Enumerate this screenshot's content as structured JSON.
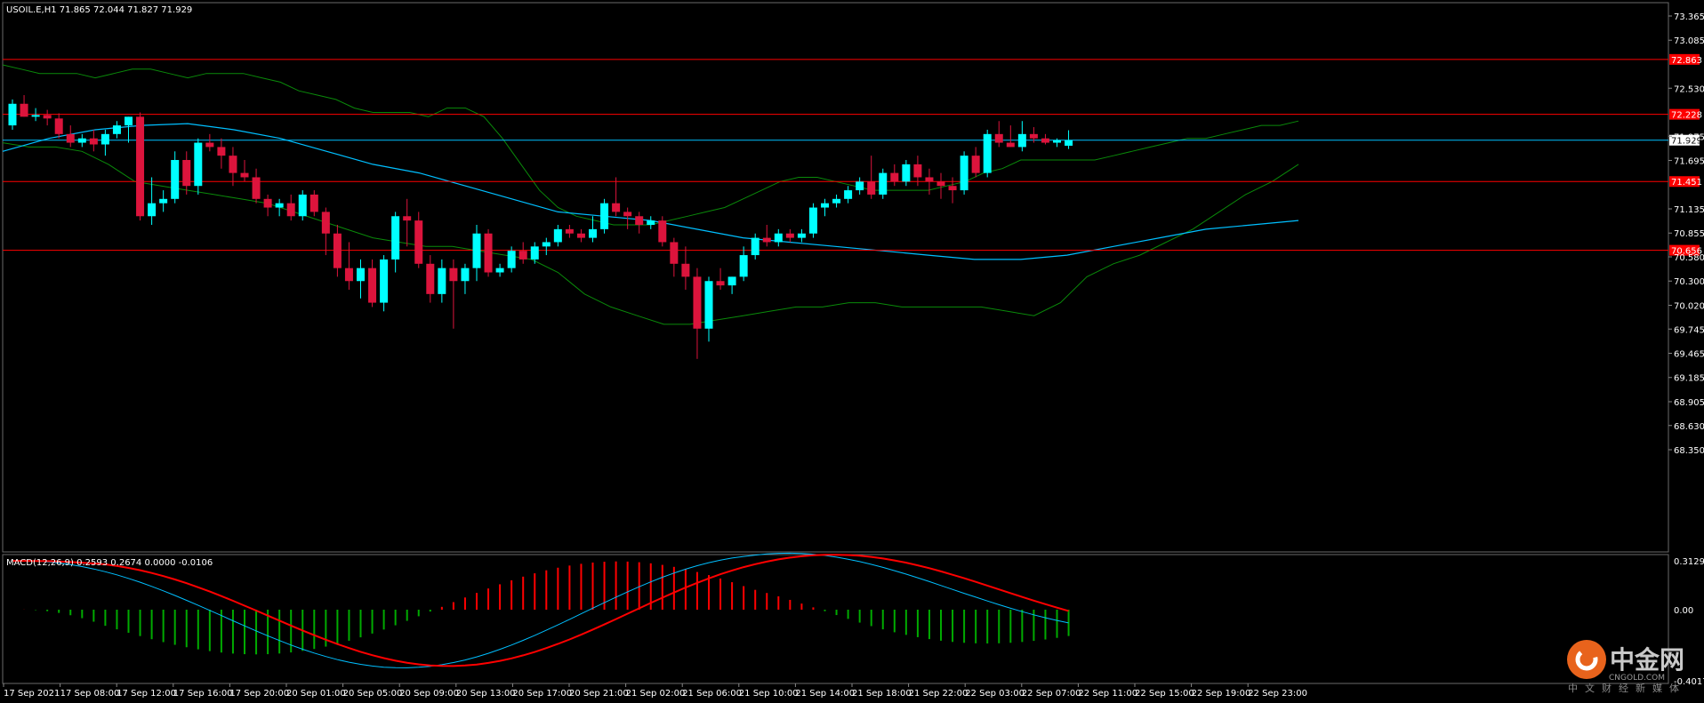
{
  "header": {
    "symbol_line": "USOIL.E,H1  71.865 72.044 71.827 71.929",
    "macd_line": "MACD(12,26,9) 0.2593 0.2674 0.0000 -0.0106"
  },
  "colors": {
    "background": "#000000",
    "bull": "#00ffff",
    "bear": "#dc143c",
    "resistance": "#ff0000",
    "bollinger": "#0a8a0a",
    "ma": "#00bfff",
    "current_price": "#00bfff",
    "macd_line": "#00bfff",
    "signal_line": "#ff0000",
    "hist_pos": "#ff0000",
    "hist_neg": "#00aa00"
  },
  "price_axis": {
    "ticks": [
      "73.365",
      "73.085",
      "72.530",
      "71.975",
      "71.695",
      "71.135",
      "70.855",
      "70.580",
      "70.300",
      "70.020",
      "69.745",
      "69.465",
      "69.185",
      "68.905",
      "68.630",
      "68.350"
    ]
  },
  "macd_axis": {
    "ticks": [
      "0.3129",
      "0.00",
      "-0.4017"
    ]
  },
  "time_axis": {
    "labels": [
      "17 Sep 2021",
      "17 Sep 08:00",
      "17 Sep 12:00",
      "17 Sep 16:00",
      "17 Sep 20:00",
      "20 Sep 01:00",
      "20 Sep 05:00",
      "20 Sep 09:00",
      "20 Sep 13:00",
      "20 Sep 17:00",
      "20 Sep 21:00",
      "21 Sep 02:00",
      "21 Sep 06:00",
      "21 Sep 10:00",
      "21 Sep 14:00",
      "21 Sep 18:00",
      "21 Sep 22:00",
      "22 Sep 03:00",
      "22 Sep 07:00",
      "22 Sep 11:00",
      "22 Sep 15:00",
      "22 Sep 19:00",
      "22 Sep 23:00"
    ]
  },
  "level_tags": {
    "l1": "72.863",
    "l2": "72.228",
    "current": "71.929",
    "l3": "71.451",
    "l4": "70.656"
  },
  "logo": {
    "cn": "中金网",
    "en": "CNGOLD.COM",
    "sub": "中文财经新媒体"
  },
  "chart_data": {
    "type": "candlestick",
    "symbol": "USOIL.E",
    "timeframe": "H1",
    "ylim": [
      68.35,
      73.5
    ],
    "horizontal_levels": [
      72.863,
      72.228,
      71.929,
      71.451,
      70.656
    ],
    "candles": [
      [
        72.1,
        72.4,
        72.05,
        72.35
      ],
      [
        72.35,
        72.45,
        72.2,
        72.2
      ],
      [
        72.2,
        72.3,
        72.15,
        72.22
      ],
      [
        72.22,
        72.28,
        72.1,
        72.18
      ],
      [
        72.18,
        72.24,
        71.95,
        72.0
      ],
      [
        72.0,
        72.1,
        71.85,
        71.9
      ],
      [
        71.9,
        72.0,
        71.85,
        71.95
      ],
      [
        71.95,
        72.05,
        71.8,
        71.88
      ],
      [
        71.88,
        72.05,
        71.75,
        72.0
      ],
      [
        72.0,
        72.15,
        71.95,
        72.1
      ],
      [
        72.1,
        72.2,
        71.9,
        72.2
      ],
      [
        72.2,
        72.25,
        71.0,
        71.05
      ],
      [
        71.05,
        71.5,
        70.95,
        71.2
      ],
      [
        71.2,
        71.35,
        71.1,
        71.25
      ],
      [
        71.25,
        71.8,
        71.2,
        71.7
      ],
      [
        71.7,
        71.8,
        71.3,
        71.4
      ],
      [
        71.4,
        71.95,
        71.3,
        71.9
      ],
      [
        71.9,
        72.0,
        71.8,
        71.85
      ],
      [
        71.85,
        71.95,
        71.6,
        71.75
      ],
      [
        71.75,
        71.85,
        71.4,
        71.55
      ],
      [
        71.55,
        71.7,
        71.45,
        71.5
      ],
      [
        71.5,
        71.6,
        71.2,
        71.25
      ],
      [
        71.25,
        71.3,
        71.05,
        71.15
      ],
      [
        71.15,
        71.25,
        71.05,
        71.2
      ],
      [
        71.2,
        71.3,
        71.0,
        71.05
      ],
      [
        71.05,
        71.35,
        71.0,
        71.3
      ],
      [
        71.3,
        71.35,
        71.05,
        71.1
      ],
      [
        71.1,
        71.15,
        70.6,
        70.85
      ],
      [
        70.85,
        70.95,
        70.35,
        70.45
      ],
      [
        70.45,
        70.75,
        70.2,
        70.3
      ],
      [
        70.3,
        70.55,
        70.1,
        70.45
      ],
      [
        70.45,
        70.55,
        70.0,
        70.05
      ],
      [
        70.05,
        70.6,
        69.95,
        70.55
      ],
      [
        70.55,
        71.1,
        70.4,
        71.05
      ],
      [
        71.05,
        71.25,
        70.7,
        71.0
      ],
      [
        71.0,
        71.1,
        70.45,
        70.5
      ],
      [
        70.5,
        70.6,
        70.05,
        70.15
      ],
      [
        70.15,
        70.55,
        70.05,
        70.45
      ],
      [
        70.45,
        70.55,
        69.75,
        70.3
      ],
      [
        70.3,
        70.5,
        70.15,
        70.45
      ],
      [
        70.45,
        70.95,
        70.3,
        70.85
      ],
      [
        70.85,
        70.9,
        70.35,
        70.4
      ],
      [
        70.4,
        70.5,
        70.35,
        70.45
      ],
      [
        70.45,
        70.7,
        70.4,
        70.65
      ],
      [
        70.65,
        70.75,
        70.5,
        70.55
      ],
      [
        70.55,
        70.75,
        70.5,
        70.7
      ],
      [
        70.7,
        70.8,
        70.6,
        70.75
      ],
      [
        70.75,
        70.95,
        70.7,
        70.9
      ],
      [
        70.9,
        70.95,
        70.8,
        70.85
      ],
      [
        70.85,
        70.9,
        70.75,
        70.8
      ],
      [
        70.8,
        71.05,
        70.75,
        70.9
      ],
      [
        70.9,
        71.25,
        70.85,
        71.2
      ],
      [
        71.2,
        71.5,
        71.05,
        71.1
      ],
      [
        71.1,
        71.15,
        70.9,
        71.05
      ],
      [
        71.05,
        71.1,
        70.85,
        70.95
      ],
      [
        70.95,
        71.05,
        70.9,
        71.0
      ],
      [
        71.0,
        71.05,
        70.7,
        70.75
      ],
      [
        70.75,
        70.8,
        70.35,
        70.5
      ],
      [
        70.5,
        70.7,
        70.2,
        70.35
      ],
      [
        70.35,
        70.45,
        69.4,
        69.75
      ],
      [
        69.75,
        70.35,
        69.6,
        70.3
      ],
      [
        70.3,
        70.45,
        70.2,
        70.25
      ],
      [
        70.25,
        70.35,
        70.15,
        70.35
      ],
      [
        70.35,
        70.7,
        70.3,
        70.6
      ],
      [
        70.6,
        70.85,
        70.55,
        70.8
      ],
      [
        70.8,
        70.95,
        70.7,
        70.75
      ],
      [
        70.75,
        70.9,
        70.7,
        70.85
      ],
      [
        70.85,
        70.9,
        70.75,
        70.8
      ],
      [
        70.8,
        70.9,
        70.75,
        70.85
      ],
      [
        70.85,
        71.2,
        70.8,
        71.15
      ],
      [
        71.15,
        71.25,
        71.05,
        71.2
      ],
      [
        71.2,
        71.3,
        71.15,
        71.25
      ],
      [
        71.25,
        71.4,
        71.2,
        71.35
      ],
      [
        71.35,
        71.5,
        71.3,
        71.45
      ],
      [
        71.45,
        71.75,
        71.25,
        71.3
      ],
      [
        71.3,
        71.6,
        71.25,
        71.55
      ],
      [
        71.55,
        71.65,
        71.4,
        71.45
      ],
      [
        71.45,
        71.7,
        71.4,
        71.65
      ],
      [
        71.65,
        71.75,
        71.4,
        71.5
      ],
      [
        71.5,
        71.6,
        71.3,
        71.45
      ],
      [
        71.45,
        71.55,
        71.25,
        71.4
      ],
      [
        71.4,
        71.5,
        71.2,
        71.35
      ],
      [
        71.35,
        71.8,
        71.3,
        71.75
      ],
      [
        71.75,
        71.85,
        71.5,
        71.55
      ],
      [
        71.55,
        72.05,
        71.5,
        72.0
      ],
      [
        72.0,
        72.15,
        71.85,
        71.9
      ],
      [
        71.9,
        72.1,
        71.85,
        71.85
      ],
      [
        71.85,
        72.15,
        71.8,
        72.0
      ],
      [
        72.0,
        72.08,
        71.9,
        71.95
      ],
      [
        71.95,
        72.0,
        71.88,
        71.9
      ],
      [
        71.9,
        71.95,
        71.85,
        71.93
      ],
      [
        71.865,
        72.044,
        71.827,
        71.929
      ]
    ],
    "bollinger_upper": [
      72.8,
      72.75,
      72.7,
      72.7,
      72.7,
      72.65,
      72.7,
      72.75,
      72.75,
      72.7,
      72.65,
      72.7,
      72.7,
      72.7,
      72.65,
      72.6,
      72.5,
      72.45,
      72.4,
      72.3,
      72.25,
      72.25,
      72.25,
      72.2,
      72.3,
      72.3,
      72.2,
      71.95,
      71.65,
      71.35,
      71.15,
      71.05,
      71.0,
      70.95,
      70.95,
      70.95,
      71.0,
      71.05,
      71.1,
      71.15,
      71.25,
      71.35,
      71.45,
      71.5,
      71.5,
      71.45,
      71.4,
      71.35,
      71.35,
      71.35,
      71.35,
      71.4,
      71.45,
      71.55,
      71.6,
      71.7,
      71.7,
      71.7,
      71.7,
      71.7,
      71.75,
      71.8,
      71.85,
      71.9,
      71.95,
      71.95,
      72.0,
      72.05,
      72.1,
      72.1,
      72.15
    ],
    "bollinger_lower": [
      71.9,
      71.85,
      71.85,
      71.8,
      71.65,
      71.45,
      71.4,
      71.35,
      71.3,
      71.25,
      71.2,
      71.1,
      71.0,
      70.9,
      70.8,
      70.75,
      70.7,
      70.7,
      70.65,
      70.6,
      70.55,
      70.4,
      70.15,
      70.0,
      69.9,
      69.8,
      69.8,
      69.85,
      69.9,
      69.95,
      70.0,
      70.0,
      70.05,
      70.05,
      70.0,
      70.0,
      70.0,
      70.0,
      69.95,
      69.9,
      70.05,
      70.35,
      70.5,
      70.6,
      70.75,
      70.9,
      71.1,
      71.3,
      71.45,
      71.65
    ],
    "ma": [
      71.8,
      71.95,
      72.05,
      72.1,
      72.12,
      72.05,
      71.95,
      71.8,
      71.65,
      71.55,
      71.4,
      71.25,
      71.1,
      71.05,
      71.0,
      70.9,
      70.8,
      70.75,
      70.7,
      70.65,
      70.6,
      70.55,
      70.55,
      70.6,
      70.7,
      70.8,
      70.9,
      70.95,
      71.0
    ]
  },
  "macd_chart_data": {
    "type": "macd",
    "params": "12,26,9",
    "values": {
      "macd": 0.2593,
      "signal": 0.2674,
      "hist": 0.0,
      "extra": -0.0106
    }
  }
}
